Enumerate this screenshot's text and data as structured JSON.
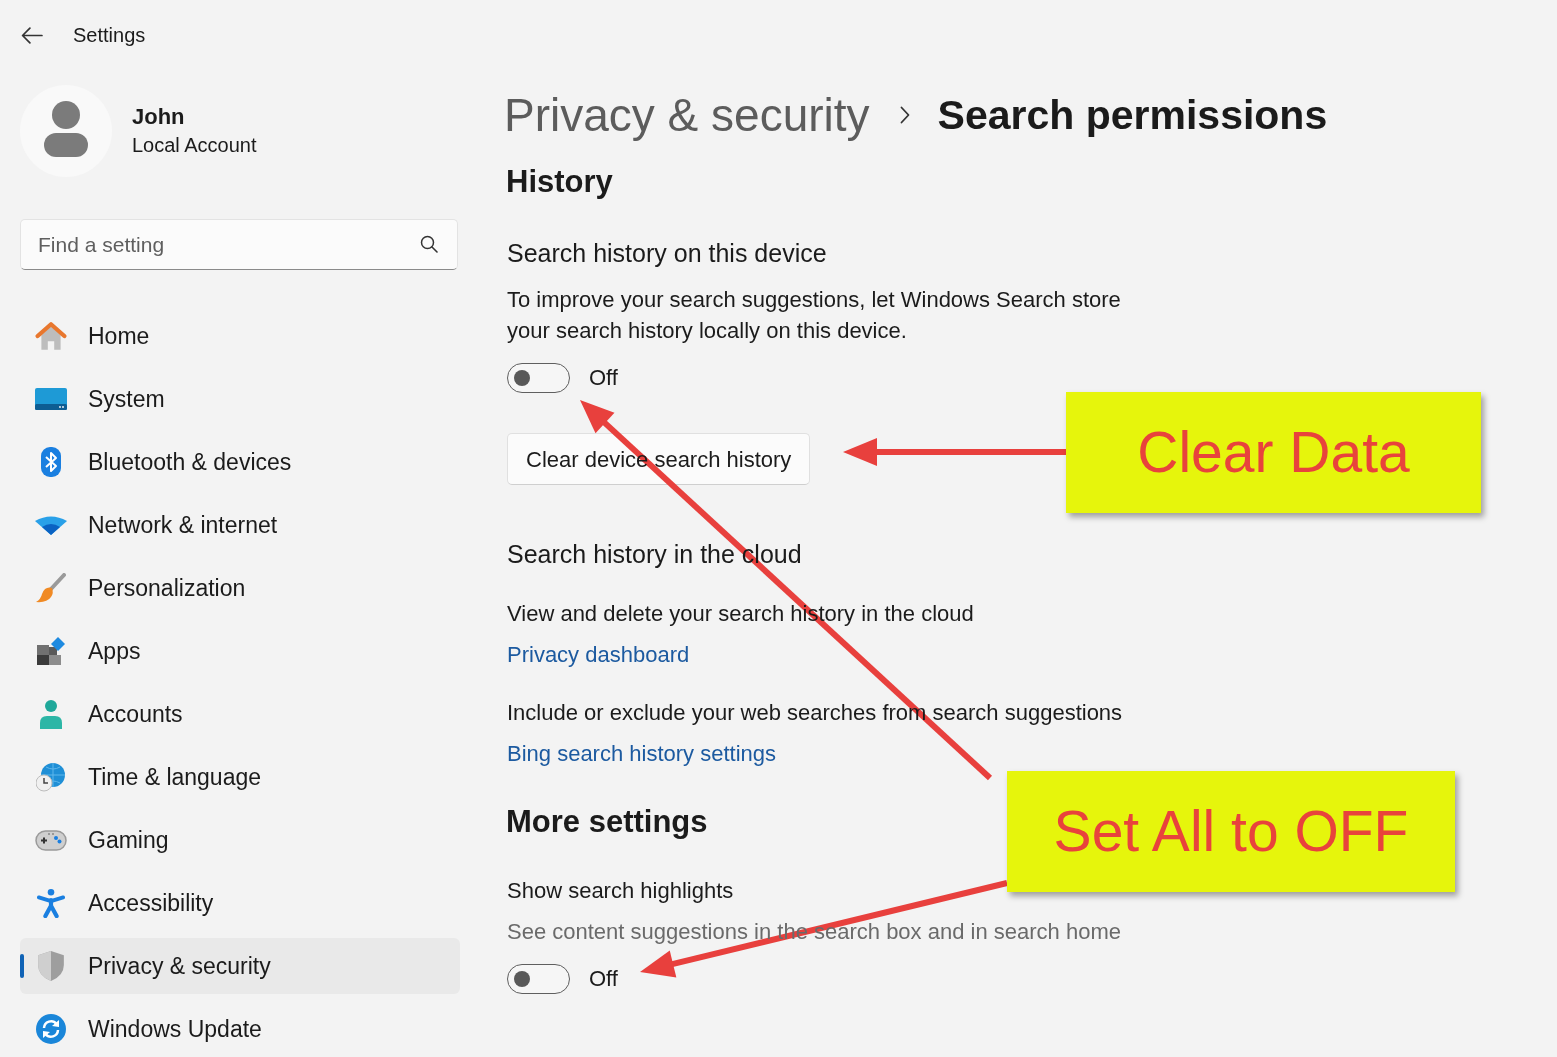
{
  "window": {
    "title": "Settings"
  },
  "profile": {
    "name": "John",
    "account_type": "Local Account"
  },
  "search": {
    "placeholder": "Find a setting"
  },
  "sidebar": {
    "items": [
      {
        "label": "Home",
        "selected": false
      },
      {
        "label": "System",
        "selected": false
      },
      {
        "label": "Bluetooth & devices",
        "selected": false
      },
      {
        "label": "Network & internet",
        "selected": false
      },
      {
        "label": "Personalization",
        "selected": false
      },
      {
        "label": "Apps",
        "selected": false
      },
      {
        "label": "Accounts",
        "selected": false
      },
      {
        "label": "Time & language",
        "selected": false
      },
      {
        "label": "Gaming",
        "selected": false
      },
      {
        "label": "Accessibility",
        "selected": false
      },
      {
        "label": "Privacy & security",
        "selected": true
      },
      {
        "label": "Windows Update",
        "selected": false
      }
    ]
  },
  "breadcrumb": {
    "parent": "Privacy & security",
    "current": "Search permissions"
  },
  "sections": [
    {
      "title": "History",
      "items": [
        {
          "kind": "subheading",
          "text": "Search history on this device"
        },
        {
          "kind": "description",
          "text": "To improve your search suggestions, let Windows Search store your search history locally on this device."
        },
        {
          "kind": "toggle",
          "on": false,
          "state_label": "Off"
        },
        {
          "kind": "button",
          "text": "Clear device search history"
        },
        {
          "kind": "subheading",
          "text": "Search history in the cloud"
        },
        {
          "kind": "text",
          "text": "View and delete your search history in the cloud"
        },
        {
          "kind": "link",
          "text": "Privacy dashboard"
        },
        {
          "kind": "text",
          "text": "Include or exclude your web searches from search suggestions"
        },
        {
          "kind": "link",
          "text": "Bing search history settings"
        }
      ]
    },
    {
      "title": "More settings",
      "items": [
        {
          "kind": "label",
          "text": "Show search highlights"
        },
        {
          "kind": "caption",
          "text": "See content suggestions in the search box and in search home"
        },
        {
          "kind": "toggle",
          "on": false,
          "state_label": "Off"
        }
      ]
    }
  ],
  "annotations": [
    {
      "kind": "callout",
      "text": "Clear Data"
    },
    {
      "kind": "callout",
      "text": "Set All to OFF"
    }
  ]
}
